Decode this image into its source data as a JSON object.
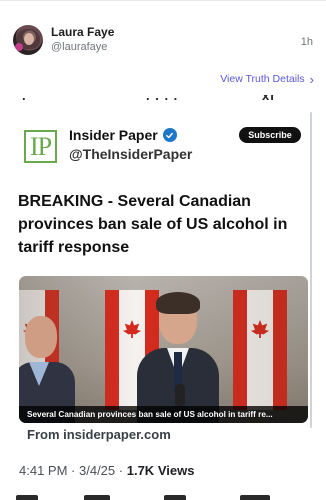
{
  "post": {
    "display_name": "Laura Faye",
    "handle": "@laurafaye",
    "time_ago": "1h",
    "view_truth_details": "View Truth Details"
  },
  "card": {
    "logo_text": "IP",
    "source_name": "Insider Paper",
    "source_handle": "@TheInsiderPaper",
    "subscribe_label": "Subscribe",
    "headline": "BREAKING - Several Canadian provinces ban sale of US alcohol in tariff response",
    "image_caption": "Several Canadian provinces ban sale of US alcohol in tariff re...",
    "link_domain": "From insiderpaper.com"
  },
  "meta": {
    "time": "4:41 PM",
    "date": "3/4/25",
    "views_count": "1.7K",
    "views_label": "Views"
  },
  "colors": {
    "accent": "#5b57d6",
    "logo_green": "#6aa84f",
    "verified_blue": "#1d77c9"
  },
  "icons": {
    "chevron": "chevron-right-icon",
    "verified": "verified-badge-icon"
  }
}
